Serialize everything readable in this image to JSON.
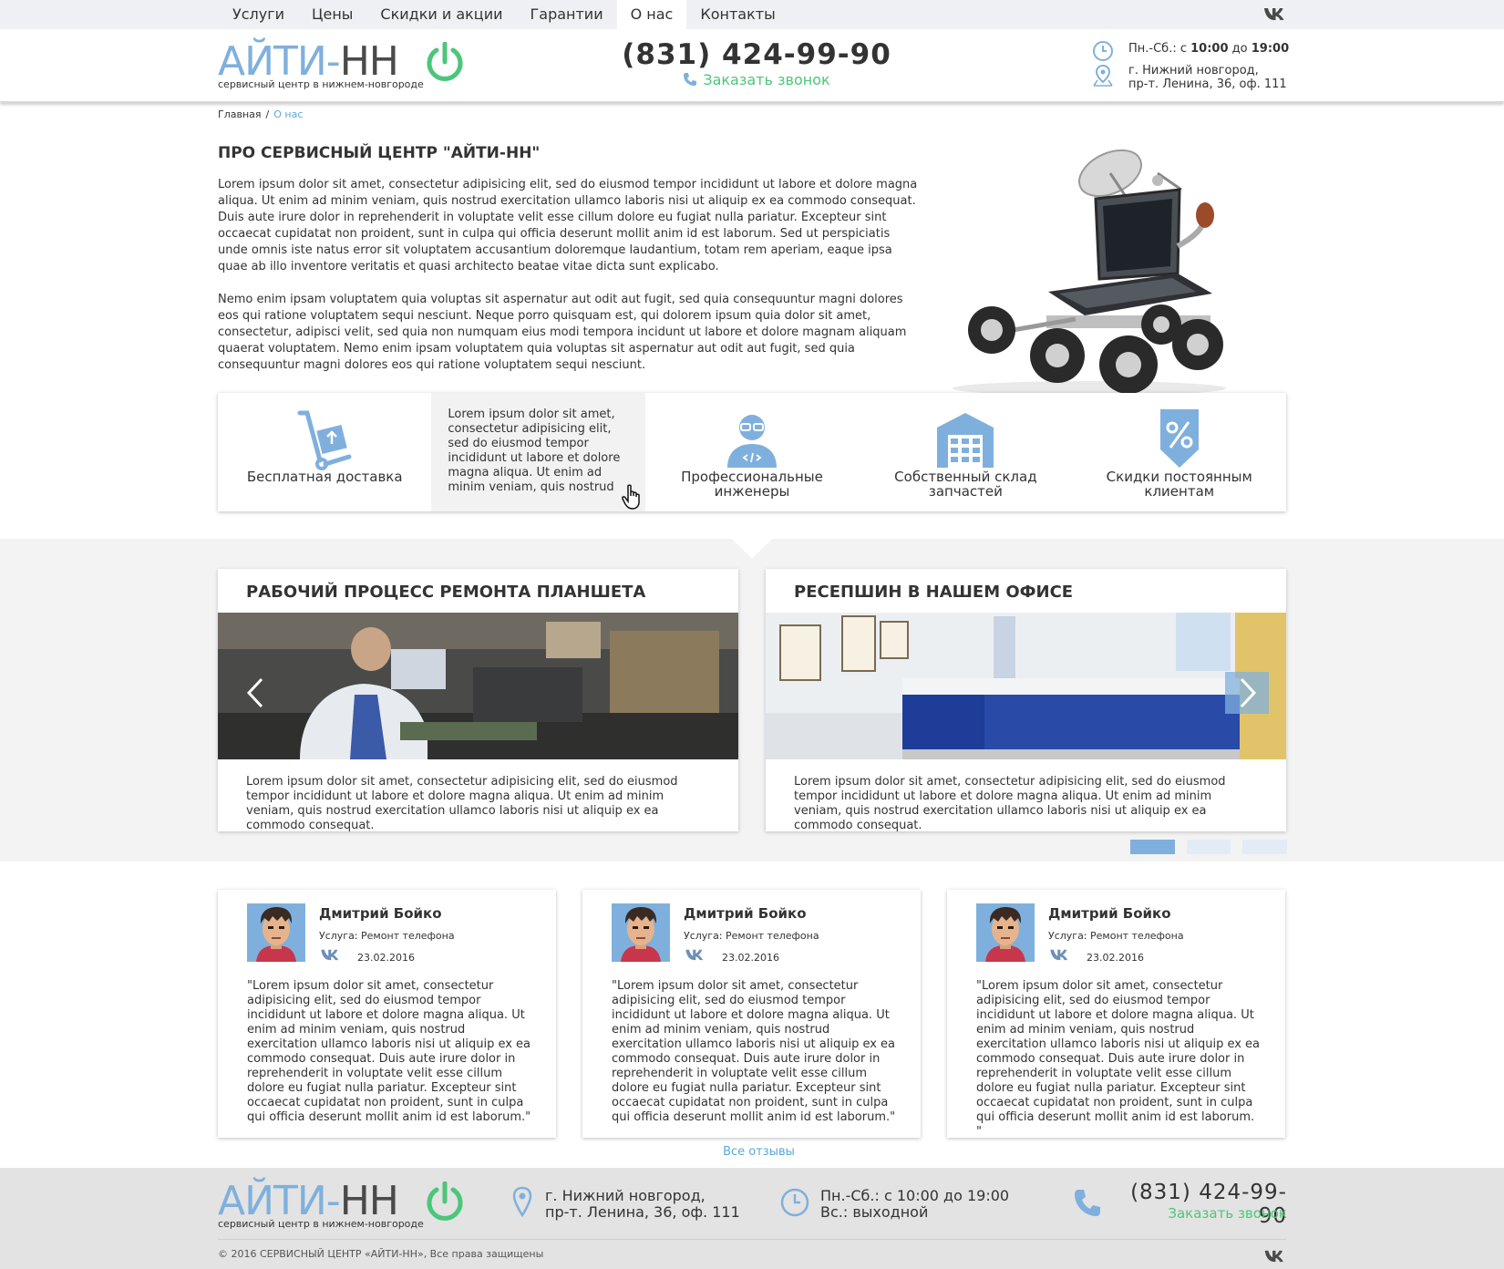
{
  "nav": {
    "items": [
      {
        "label": "Услуги"
      },
      {
        "label": "Цены"
      },
      {
        "label": "Скидки и акции"
      },
      {
        "label": "Гарантии"
      },
      {
        "label": "О нас",
        "active": true
      },
      {
        "label": "Контакты"
      }
    ],
    "vk_icon": "vk-icon"
  },
  "brand": {
    "logo_part1": "АЙТИ-",
    "logo_part2": "НН",
    "tagline": "сервисный центр в нижнем-новгороде",
    "accent_blue": "#7fb0dd",
    "accent_green": "#4cc67a"
  },
  "header": {
    "phone": "(831) 424-99-90",
    "callback": "Заказать звонок",
    "hours_prefix": "Пн.-Сб.: с ",
    "hours_from": "10:00",
    "hours_mid": " до ",
    "hours_to": "19:00",
    "address_line1": "г. Нижний новгород,",
    "address_line2": "пр-т. Ленина, 36, оф. 111"
  },
  "breadcrumb": {
    "home": "Главная",
    "separator": "/",
    "current": "О нас"
  },
  "about": {
    "title": "ПРО СЕРВИСНЫЙ ЦЕНТР \"АЙТИ-НН\"",
    "paragraph1": "Lorem ipsum dolor sit amet, consectetur adipisicing elit, sed do eiusmod tempor incididunt ut labore et dolore magna aliqua. Ut enim ad minim veniam, quis nostrud exercitation ullamco laboris nisi ut aliquip ex ea commodo consequat. Duis aute irure dolor in reprehenderit in voluptate velit esse cillum dolore eu fugiat nulla pariatur. Excepteur sint occaecat cupidatat non proident, sunt in culpa qui officia deserunt mollit anim id est laborum. Sed ut perspiciatis unde omnis iste natus error sit voluptatem accusantium doloremque laudantium, totam rem aperiam, eaque ipsa quae ab illo inventore veritatis et quasi architecto beatae vitae dicta sunt explicabo.",
    "paragraph2": "Nemo enim ipsam voluptatem quia voluptas sit aspernatur aut odit aut fugit, sed quia consequuntur magni dolores eos qui ratione voluptatem sequi nesciunt. Neque porro quisquam est, qui dolorem ipsum quia dolor sit amet, consectetur, adipisci velit, sed quia non numquam eius modi tempora incidunt ut labore et dolore magnam aliquam quaerat voluptatem. Nemo enim ipsam voluptatem quia voluptas sit aspernatur aut odit aut fugit, sed quia consequuntur magni dolores eos qui ratione voluptatem sequi nesciunt."
  },
  "features": {
    "delivery": {
      "label": "Бесплатная доставка",
      "icon": "hand-truck-icon"
    },
    "hover_text": "Lorem ipsum dolor sit amet, consectetur adipisicing elit, sed do eiusmod tempor incididunt ut labore et dolore magna aliqua. Ut enim ad minim veniam, quis nostrud",
    "engineers": {
      "label": "Профессиональные инженеры",
      "icon": "engineer-icon"
    },
    "warehouse": {
      "label": "Собственный склад запчастей",
      "icon": "warehouse-icon"
    },
    "discounts": {
      "label": "Скидки постоянным клиентам",
      "icon": "discount-icon"
    }
  },
  "gallery": {
    "card1": {
      "title": "РАБОЧИЙ ПРОЦЕСС РЕМОНТА ПЛАНШЕТА",
      "text": "Lorem ipsum dolor sit amet, consectetur adipisicing elit, sed do eiusmod tempor incididunt ut labore et dolore magna aliqua. Ut enim ad minim veniam, quis nostrud exercitation ullamco laboris nisi ut aliquip ex ea commodo consequat."
    },
    "card2": {
      "title": "РЕСЕПШИН В НАШЕМ ОФИСЕ",
      "text": "Lorem ipsum dolor sit amet, consectetur adipisicing elit, sed do eiusmod tempor incididunt ut labore et dolore magna aliqua. Ut enim ad minim veniam, quis nostrud exercitation ullamco laboris nisi ut aliquip ex ea commodo consequat."
    },
    "pager": {
      "pages": 3,
      "active": 1
    }
  },
  "reviews": {
    "items": [
      {
        "name": "Дмитрий Бойко",
        "service": "Услуга: Ремонт телефона",
        "date": "23.02.2016",
        "text": "\"Lorem ipsum dolor sit amet, consectetur adipisicing elit, sed do eiusmod tempor incididunt ut labore et dolore magna aliqua. Ut enim ad minim veniam, quis nostrud exercitation ullamco laboris nisi ut aliquip ex ea commodo consequat. Duis aute irure dolor in reprehenderit in voluptate velit esse cillum dolore eu fugiat nulla pariatur. Excepteur sint occaecat cupidatat non proident, sunt in culpa qui officia deserunt mollit anim id est laborum.\""
      },
      {
        "name": "Дмитрий Бойко",
        "service": "Услуга: Ремонт телефона",
        "date": "23.02.2016",
        "text": "\"Lorem ipsum dolor sit amet, consectetur adipisicing elit, sed do eiusmod tempor incididunt ut labore et dolore magna aliqua. Ut enim ad minim veniam, quis nostrud exercitation ullamco laboris nisi ut aliquip ex ea commodo consequat. Duis aute irure dolor in reprehenderit in voluptate velit esse cillum dolore eu fugiat nulla pariatur. Excepteur sint occaecat cupidatat non proident, sunt in culpa qui officia deserunt mollit anim id est laborum.\""
      },
      {
        "name": "Дмитрий Бойко",
        "service": "Услуга: Ремонт телефона",
        "date": "23.02.2016",
        "text": "\"Lorem ipsum dolor sit amet, consectetur adipisicing elit, sed do eiusmod tempor incididunt ut labore et dolore magna aliqua. Ut enim ad minim veniam, quis nostrud exercitation ullamco laboris nisi ut aliquip ex ea commodo consequat. Duis aute irure dolor in reprehenderit in voluptate velit esse cillum dolore eu fugiat nulla pariatur. Excepteur sint occaecat cupidatat non proident, sunt in culpa qui officia deserunt mollit anim id est laborum. \""
      }
    ],
    "all_link": "Все отзывы"
  },
  "footer": {
    "address_line1": "г. Нижний новгород,",
    "address_line2": "пр-т. Ленина, 36, оф. 111",
    "hours_line1": "Пн.-Сб.: с 10:00 до 19:00",
    "hours_line2": "Вс.: выходной",
    "phone": "(831) 424-99-90",
    "callback": "Заказать звонок",
    "copyright": "© 2016 СЕРВИСНЫЙ ЦЕНТР «АЙТИ-НН», Все права защищены"
  }
}
